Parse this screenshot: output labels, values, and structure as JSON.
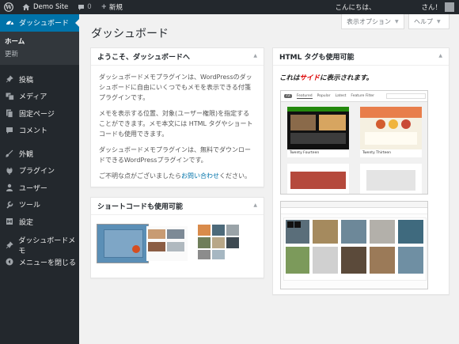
{
  "adminbar": {
    "site_name": "Demo Site",
    "comments_count": "0",
    "new_label": "新規",
    "greeting": "こんにちは、",
    "user": "さん！"
  },
  "menu": {
    "dashboard": "ダッシュボード",
    "home": "ホーム",
    "updates": "更新",
    "posts": "投稿",
    "media": "メディア",
    "pages": "固定ページ",
    "comments": "コメント",
    "appearance": "外観",
    "plugins": "プラグイン",
    "users": "ユーザー",
    "tools": "ツール",
    "settings": "設定",
    "dashboard_memo": "ダッシュボードメモ",
    "collapse": "メニューを閉じる"
  },
  "screen": {
    "options": "表示オプション",
    "help": "ヘルプ"
  },
  "page_title": "ダッシュボード",
  "welcome": {
    "title": "ようこそ、ダッシュボードへ",
    "p1": "ダッシュボードメモプラグインは、WordPressのダッシュボードに自由にいくつでもメモを表示できる付箋プラグインです。",
    "p2": "メモを表示する位置、対象(ユーザー権限)を指定することができます。メモ本文には HTML タグやショートコードも使用できます。",
    "p3": "ダッシュボードメモプラグインは、無料でダウンロードできるWordPressプラグインです。",
    "p4_before": "ご不明な点がございましたら",
    "p4_link": "お問い合わせ",
    "p4_after": "ください。"
  },
  "shortcode": {
    "title": "ショートコードも使用可能"
  },
  "html": {
    "title": "HTML タグも使用可能",
    "line_prefix": "これは",
    "line_red": "サイド",
    "line_suffix": "に表示されます。",
    "theme1": "Twenty Fourteen",
    "theme2": "Twenty Thirteen",
    "tab_featured": "Featured",
    "tab_popular": "Popular",
    "tab_latest": "Latest",
    "tab_filter": "Feature Filter",
    "count": "72"
  },
  "colors": {
    "accent": "#0073aa",
    "adminbar": "#23282d",
    "red": "#dd0000"
  }
}
